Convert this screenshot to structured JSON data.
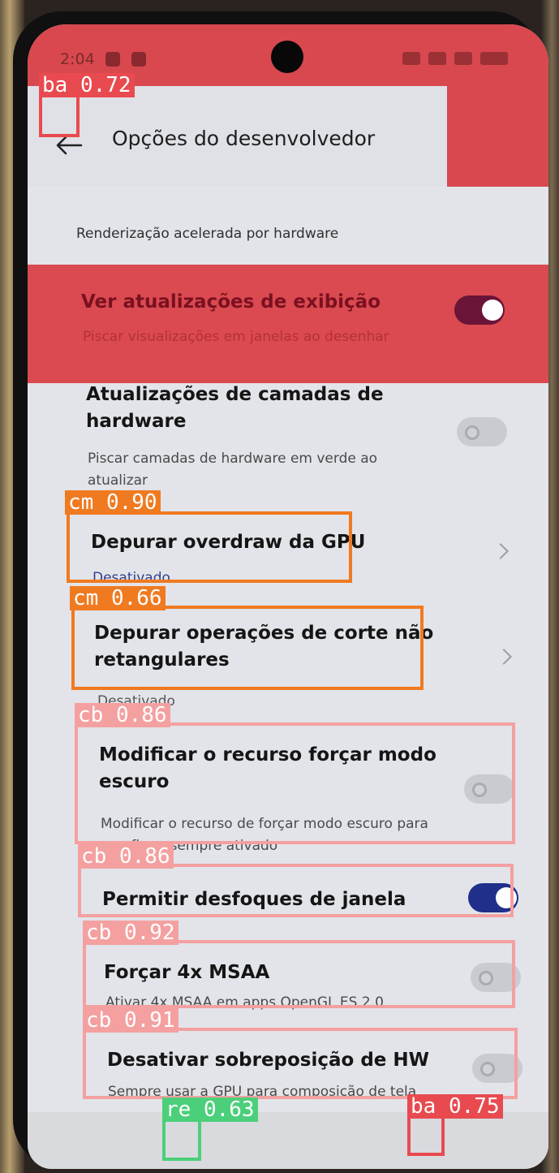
{
  "status_bar": {
    "time": "2:04"
  },
  "app_bar": {
    "title": "Opções do desenvolvedor",
    "back_icon": "arrow-left-icon"
  },
  "section_header": "Renderização acelerada por hardware",
  "settings": [
    {
      "title": "Ver atualizações de exibição",
      "subtitle": "Piscar visualizações em janelas ao desenhar",
      "control": "toggle",
      "on": true
    },
    {
      "title": "Atualizações de camadas de hardware",
      "subtitle": "Piscar camadas de hardware em verde ao atualizar",
      "control": "toggle",
      "on": false
    },
    {
      "title": "Depurar overdraw da GPU",
      "value": "Desativado",
      "control": "chevron"
    },
    {
      "title": "Depurar operações de corte não retangulares",
      "value": "Desativado",
      "control": "chevron"
    },
    {
      "title": "Modificar o recurso forçar modo escuro",
      "subtitle": "Modificar o recurso de forçar modo escuro para que fique sempre ativado",
      "control": "toggle",
      "on": false
    },
    {
      "title": "Permitir desfoques de janela",
      "control": "toggle",
      "on": true
    },
    {
      "title": "Forçar 4x MSAA",
      "subtitle": "Ativar 4x MSAA em apps OpenGL ES 2.0",
      "control": "toggle",
      "on": false
    },
    {
      "title": "Desativar sobreposição de HW",
      "subtitle": "Sempre usar a GPU para composição de tela",
      "control": "toggle",
      "on": false
    }
  ],
  "detections": [
    {
      "label": "ba 0.72",
      "color": "#e84a4f"
    },
    {
      "label": "cm 0.90",
      "color": "#f07a20"
    },
    {
      "label": "cm 0.66",
      "color": "#f07a20"
    },
    {
      "label": "cb 0.86",
      "color": "#f4a0a0"
    },
    {
      "label": "cb 0.86",
      "color": "#f4a0a0"
    },
    {
      "label": "cb 0.92",
      "color": "#f4a0a0"
    },
    {
      "label": "cb 0.91",
      "color": "#f4a0a0"
    },
    {
      "label": "re 0.63",
      "color": "#4ccf7a"
    },
    {
      "label": "ba 0.75",
      "color": "#e84a4f"
    }
  ],
  "colors": {
    "highlight": "#da4a50",
    "toggle_on": "#1f2f8a",
    "toggle_off": "#c9cbd0",
    "link_value": "#2f3f8f"
  }
}
